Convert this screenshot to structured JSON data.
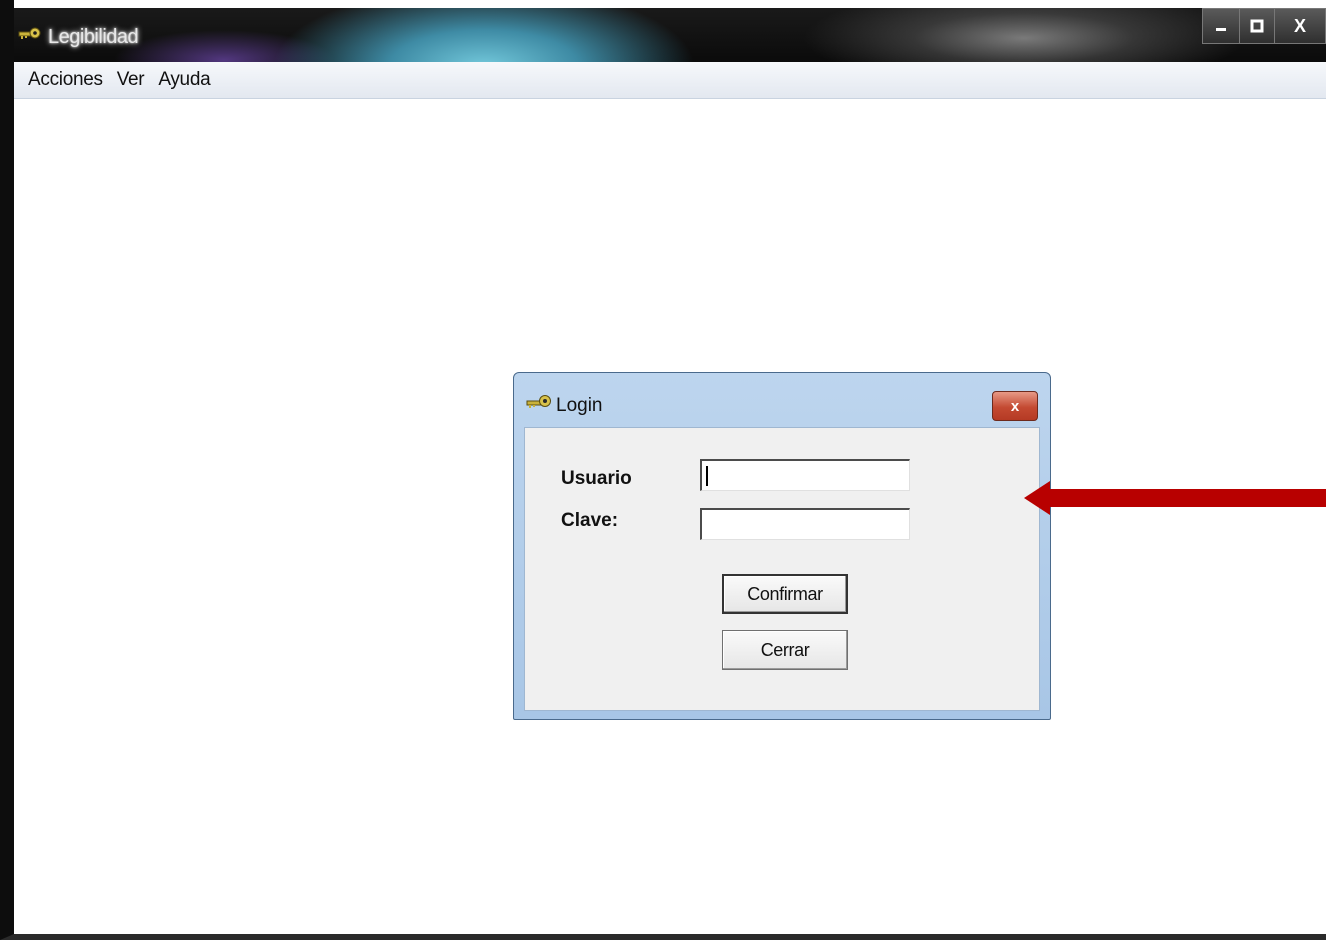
{
  "window": {
    "title": "Legibilidad",
    "icon": "key-icon",
    "controls": {
      "minimize": "minimize-icon",
      "maximize": "maximize-icon",
      "close_label": "X"
    }
  },
  "menubar": {
    "items": [
      {
        "label": "Acciones"
      },
      {
        "label": "Ver"
      },
      {
        "label": "Ayuda"
      }
    ]
  },
  "login_dialog": {
    "title": "Login",
    "icon": "key-icon",
    "close_label": "x",
    "usuario_label": "Usuario",
    "usuario_value": "",
    "clave_label": "Clave:",
    "clave_value": "",
    "confirm_label": "Confirmar",
    "close_button_label": "Cerrar"
  },
  "annotation": {
    "arrow_color": "#b80000",
    "direction": "left"
  }
}
